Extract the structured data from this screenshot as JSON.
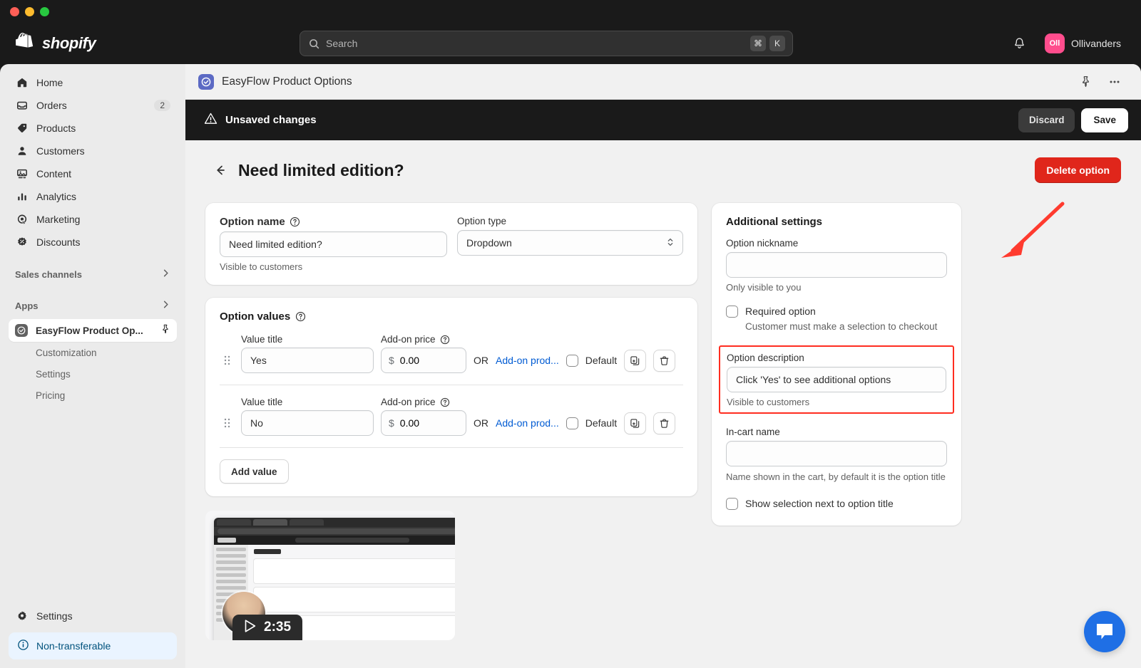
{
  "window": {
    "traffic_lights": [
      "close",
      "minimize",
      "maximize"
    ]
  },
  "topbar": {
    "brand": "shopify",
    "search": {
      "placeholder": "Search",
      "keys": [
        "⌘",
        "K"
      ]
    },
    "notifications_icon": "bell-icon",
    "account": {
      "initials": "Oll",
      "name": "Ollivanders"
    }
  },
  "sidebar": {
    "items": [
      {
        "label": "Home",
        "icon": "home-icon",
        "badge": ""
      },
      {
        "label": "Orders",
        "icon": "orders-icon",
        "badge": "2"
      },
      {
        "label": "Products",
        "icon": "products-tag-icon",
        "badge": ""
      },
      {
        "label": "Customers",
        "icon": "customers-person-icon",
        "badge": ""
      },
      {
        "label": "Content",
        "icon": "content-image-icon",
        "badge": ""
      },
      {
        "label": "Analytics",
        "icon": "analytics-bars-icon",
        "badge": ""
      },
      {
        "label": "Marketing",
        "icon": "marketing-target-icon",
        "badge": ""
      },
      {
        "label": "Discounts",
        "icon": "discounts-badge-icon",
        "badge": ""
      }
    ],
    "groups": [
      {
        "label": "Sales channels"
      },
      {
        "label": "Apps"
      }
    ],
    "active_app": {
      "label": "EasyFlow Product Op...",
      "icon": "easyflow-app-icon",
      "pin_icon": "pin-icon"
    },
    "app_sub_items": [
      {
        "label": "Customization"
      },
      {
        "label": "Settings"
      },
      {
        "label": "Pricing"
      }
    ],
    "settings": {
      "label": "Settings",
      "icon": "gear-icon"
    },
    "non_transferable": {
      "label": "Non-transferable",
      "icon": "info-circle-icon"
    }
  },
  "app_header": {
    "title": "EasyFlow Product Options",
    "app_icon": "easyflow-app-icon",
    "pin_icon": "pin-icon",
    "more_icon": "more-horizontal-icon"
  },
  "unsaved_bar": {
    "message": "Unsaved changes",
    "warning_icon": "warning-triangle-icon",
    "discard_label": "Discard",
    "save_label": "Save"
  },
  "page": {
    "back_icon": "arrow-left-icon",
    "title": "Need limited edition?",
    "delete_label": "Delete option",
    "delete_color": "#e0261b"
  },
  "option_name_card": {
    "name_label": "Option name",
    "name_help_icon": "question-circle-icon",
    "name_value": "Need limited edition?",
    "name_helper": "Visible to customers",
    "type_label": "Option type",
    "type_value": "Dropdown",
    "type_chevron_icon": "chevron-updown-icon"
  },
  "option_values_card": {
    "title": "Option values",
    "title_help_icon": "question-circle-icon",
    "col_value_title": "Value title",
    "col_addon_price": "Add-on price",
    "price_help_icon": "question-circle-icon",
    "or_text": "OR",
    "addon_product_link": "Add-on prod...",
    "default_label": "Default",
    "currency_symbol": "$",
    "duplicate_icon": "duplicate-icon",
    "delete_icon": "trash-icon",
    "drag_icon": "drag-handle-icon",
    "rows": [
      {
        "title": "Yes",
        "price": "0.00",
        "default_checked": false
      },
      {
        "title": "No",
        "price": "0.00",
        "default_checked": false
      }
    ],
    "add_value_label": "Add value"
  },
  "additional_settings": {
    "title": "Additional settings",
    "nickname_label": "Option nickname",
    "nickname_value": "",
    "nickname_helper": "Only visible to you",
    "required_label": "Required option",
    "required_checked": false,
    "required_helper": "Customer must make a selection to checkout",
    "description_label": "Option description",
    "description_value": "Click 'Yes' to see additional options",
    "description_helper": "Visible to customers",
    "description_highlight_color": "#ff2d20",
    "incart_label": "In-cart name",
    "incart_value": "",
    "incart_helper": "Name shown in the cart, by default it is the option title",
    "show_selection_label": "Show selection next to option title",
    "show_selection_checked": false
  },
  "video": {
    "duration": "2:35",
    "play_icon": "play-triangle-icon"
  },
  "annotation": {
    "arrow_icon": "red-arrow-pointer",
    "arrow_color": "#ff3b2f"
  },
  "chat": {
    "icon": "chat-bubble-icon",
    "color": "#1f6fe5"
  }
}
